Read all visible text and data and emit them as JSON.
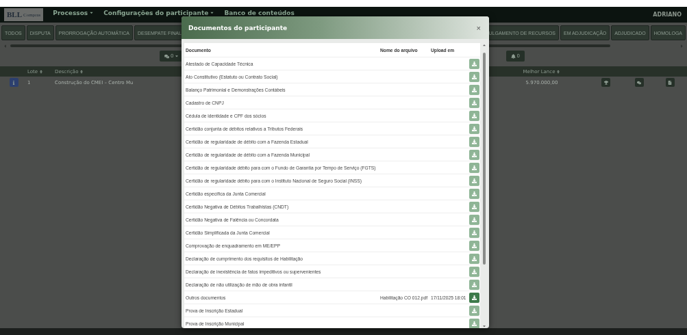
{
  "navbar": {
    "logo": "BLL",
    "logo_sub": "Compras",
    "menus": [
      {
        "label": "Processos",
        "dropdown": true
      },
      {
        "label": "Configurações do participante",
        "dropdown": true
      },
      {
        "label": "Banco de conteúdos",
        "dropdown": false
      }
    ],
    "user": "ADRIANO"
  },
  "status_tabs_left": [
    "TODOS",
    "DISPUTA",
    "PRORROGAÇÃO AUTOMÁTICA",
    "DESEMPATE FINAL"
  ],
  "status_tabs_right": [
    "ULGAMENTO DE RECURSOS",
    "EM ADJUDICAÇÃO",
    "ADJUDICADO",
    "HOMOLOGA"
  ],
  "toolbar": {
    "messages_count": "0",
    "alerts_count": "0"
  },
  "lots_table": {
    "columns": [
      "Lote",
      "Descrição",
      "Melhor Lance"
    ],
    "rows": [
      {
        "lote": "1",
        "descricao": "Construção do CMEI – Centro Mu",
        "melhor_lance": "5.970.000,00"
      }
    ]
  },
  "modal": {
    "title": "Documentos do participante",
    "close": "×",
    "columns": [
      "Documento",
      "Nome do arquivo",
      "Upload em"
    ],
    "rows": [
      {
        "documento": "Atestado de Capacidade Técnica",
        "disabled": true
      },
      {
        "documento": "Ato Constitutivo (Estatuto ou Contrato Social)",
        "disabled": true
      },
      {
        "documento": "Balanço Patrimonial e Demonstrações Contábeis",
        "disabled": true
      },
      {
        "documento": "Cadastro de CNPJ",
        "disabled": true
      },
      {
        "documento": "Cédula de identidade e CPF dos sócios",
        "disabled": true
      },
      {
        "documento": "Certidão conjunta de débitos relativos a Tributos Federais",
        "disabled": true
      },
      {
        "documento": "Certidão de regularidade de débito com a Fazenda Estadual",
        "disabled": true
      },
      {
        "documento": "Certidão de regularidade de débito com a Fazenda Municipal",
        "disabled": true
      },
      {
        "documento": "Certidão de regularidade débito para com o Fundo de Garantia por Tempo de Serviço (FGTS)",
        "disabled": true
      },
      {
        "documento": "Certidão de regularidade débito para com o Instituto Nacional de Seguro Social (INSS)",
        "disabled": true
      },
      {
        "documento": "Certidão específica da Junta Comercial",
        "disabled": true
      },
      {
        "documento": "Certidão Negativa de Débitos Trabalhistas (CNDT)",
        "disabled": true
      },
      {
        "documento": "Certidão Negativa de Falência ou Concordata",
        "disabled": true
      },
      {
        "documento": "Certidão Simplificada da Junta Comercial",
        "disabled": true
      },
      {
        "documento": "Comprovação de enquadramento em ME/EPP",
        "disabled": true
      },
      {
        "documento": "Declaração de cumprimento dos requisitos de Habilitação",
        "disabled": true
      },
      {
        "documento": "Declaração de inexistência de fatos impeditivos ou supervenientes",
        "disabled": true
      },
      {
        "documento": "Declaração de não utilização de mão de obra infantil",
        "disabled": true
      },
      {
        "documento": "Outros documentos",
        "nome_arquivo": "Habilitação CO 012.pdf",
        "upload_em": "17/11/2025 18:01",
        "disabled": false
      },
      {
        "documento": "Prova de Inscrição Estadual",
        "disabled": true
      },
      {
        "documento": "Prova de Inscrição Municipal",
        "disabled": true
      }
    ]
  }
}
